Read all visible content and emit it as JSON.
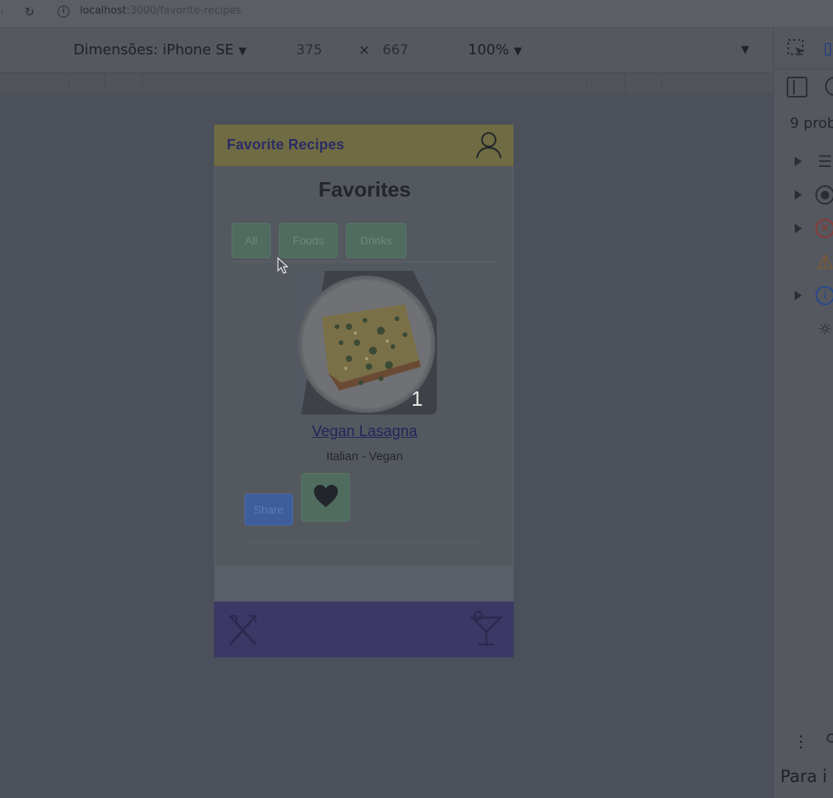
{
  "browser": {
    "url_host": "localhost",
    "url_path": ":3000/favorite-recipes"
  },
  "device_toolbar": {
    "dimensions_label": "Dimensões: iPhone SE",
    "width": "375",
    "times": "×",
    "height": "667",
    "zoom": "100%"
  },
  "devtools": {
    "problems_label": "9 prob",
    "footer_text": "Para i"
  },
  "app": {
    "header_title": "Favorite Recipes",
    "page_title": "Favorites",
    "filters": [
      "All",
      "Foods",
      "Drinks"
    ],
    "recipe": {
      "index": "1",
      "name": "Vegan Lasagna",
      "category": "Italian - Vegan"
    },
    "share_label": "Share"
  },
  "colors": {
    "header": "#6f6b42",
    "footer": "#3b3866",
    "filter_button": "#4f6c5e",
    "share_button": "#3d5e9a"
  }
}
